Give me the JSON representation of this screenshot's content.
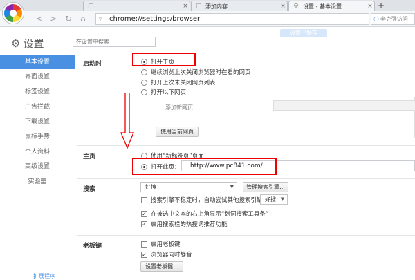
{
  "tabs": [
    {
      "label": "",
      "state": "inactive"
    },
    {
      "label": "添加内容",
      "state": "inactive"
    },
    {
      "label": "设置 - 基本设置",
      "state": "active"
    }
  ],
  "newtab_label": "+",
  "toolbar": {
    "url": "chrome://settings/browser",
    "search_placeholder": "李克强访问"
  },
  "sidebar": {
    "title": "设置",
    "items": [
      {
        "label": "基本设置",
        "active": true
      },
      {
        "label": "界面设置"
      },
      {
        "label": "标签设置"
      },
      {
        "label": "广告拦截"
      },
      {
        "label": "下载设置"
      },
      {
        "label": "鼠标手势"
      },
      {
        "label": "个人资料"
      },
      {
        "label": "高级设置"
      },
      {
        "label": "实验室"
      }
    ],
    "bottom_link": "扩展程序"
  },
  "search_settings_placeholder": "在设置中搜索",
  "saved_tag": "设置已保存",
  "startup": {
    "label": "启动时",
    "options": [
      "打开主页",
      "继续浏览上次关闭浏览器时在看的网页",
      "打开上次未关闭网页列表",
      "打开以下网页"
    ],
    "add_page_placeholder": "添加新网页",
    "use_current_button": "使用当前网页"
  },
  "homepage": {
    "label": "主页",
    "option_newtab": "使用“新标签页”页面",
    "option_open_page": "打开此页：",
    "url_value": "http://www.pc841.com/"
  },
  "search": {
    "label": "搜索",
    "engine": "好搜",
    "manage_button": "管理搜索引擎...",
    "fallback_label": "搜索引擎不稳定时，自动尝试其他搜索引擎：",
    "fallback_engine": "好搜",
    "option_toolbar": "在被选中文本的右上角显示“划词搜索工具条”",
    "option_hot": "启用搜索栏的热搜词推荐功能"
  },
  "bosskey": {
    "label": "老板键",
    "option_enable": "启用老板键",
    "option_mute": "浏览器同时静音",
    "settings_button": "设置老板键..."
  },
  "colors": {
    "accent": "#4a90e2",
    "annotation": "#e00000"
  }
}
